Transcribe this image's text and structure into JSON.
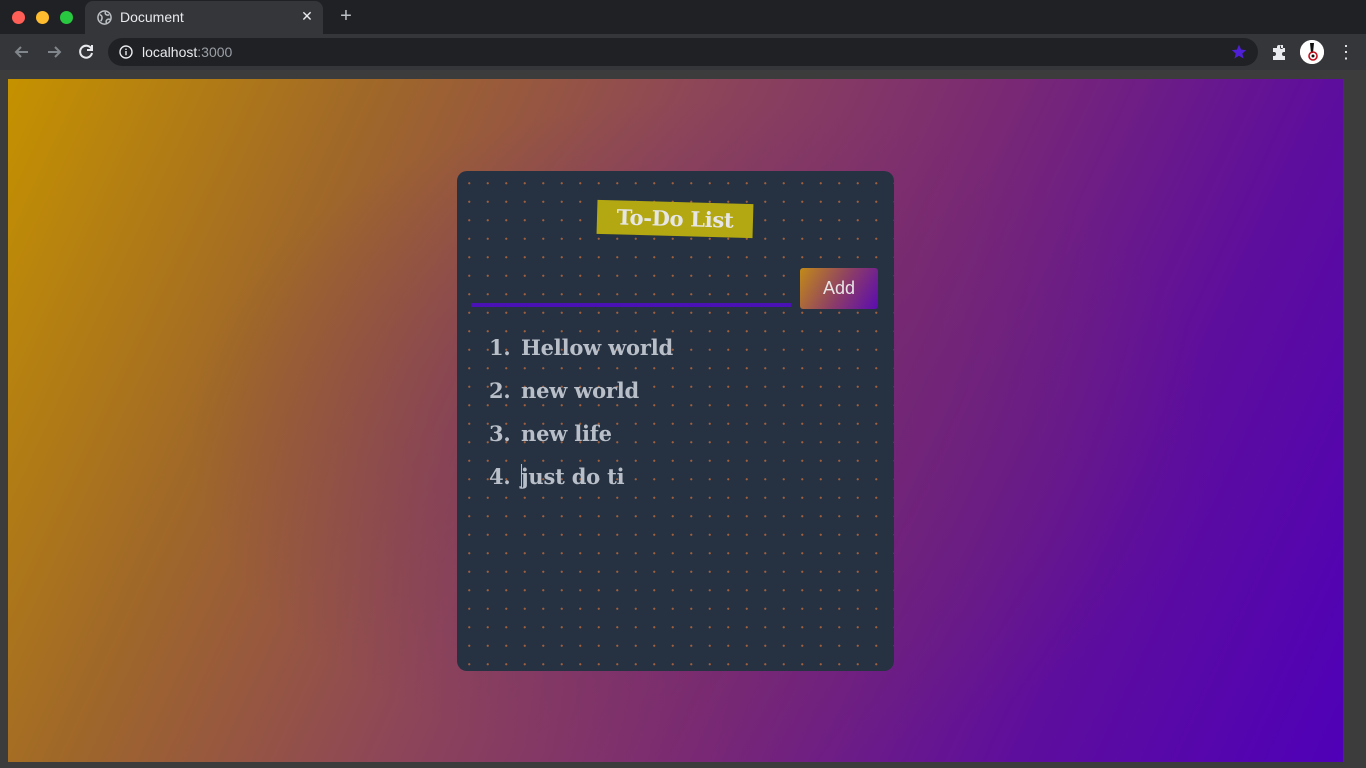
{
  "browser": {
    "tab_title": "Document",
    "close_glyph": "✕",
    "new_tab_glyph": "+",
    "url_host": "localhost",
    "url_port": ":3000",
    "menu_glyph": "⋮"
  },
  "app": {
    "title": "To-Do List",
    "input_value": "",
    "add_label": "Add",
    "items": [
      {
        "num": "1.",
        "text": "Hellow world"
      },
      {
        "num": "2.",
        "text": "new world"
      },
      {
        "num": "3.",
        "text": "new life"
      },
      {
        "num": "4.",
        "text": "just do ti"
      }
    ]
  },
  "colors": {
    "card_bg": "#263241",
    "title_badge": "#b3a812",
    "input_underline": "#4a12b5",
    "gradient_start": "#c59200",
    "gradient_end": "#4f00b8"
  },
  "icons": [
    "globe-icon",
    "close-icon",
    "plus-icon",
    "back-arrow-icon",
    "forward-arrow-icon",
    "reload-icon",
    "info-icon",
    "star-icon",
    "extensions-icon",
    "avatar",
    "menu-icon"
  ]
}
